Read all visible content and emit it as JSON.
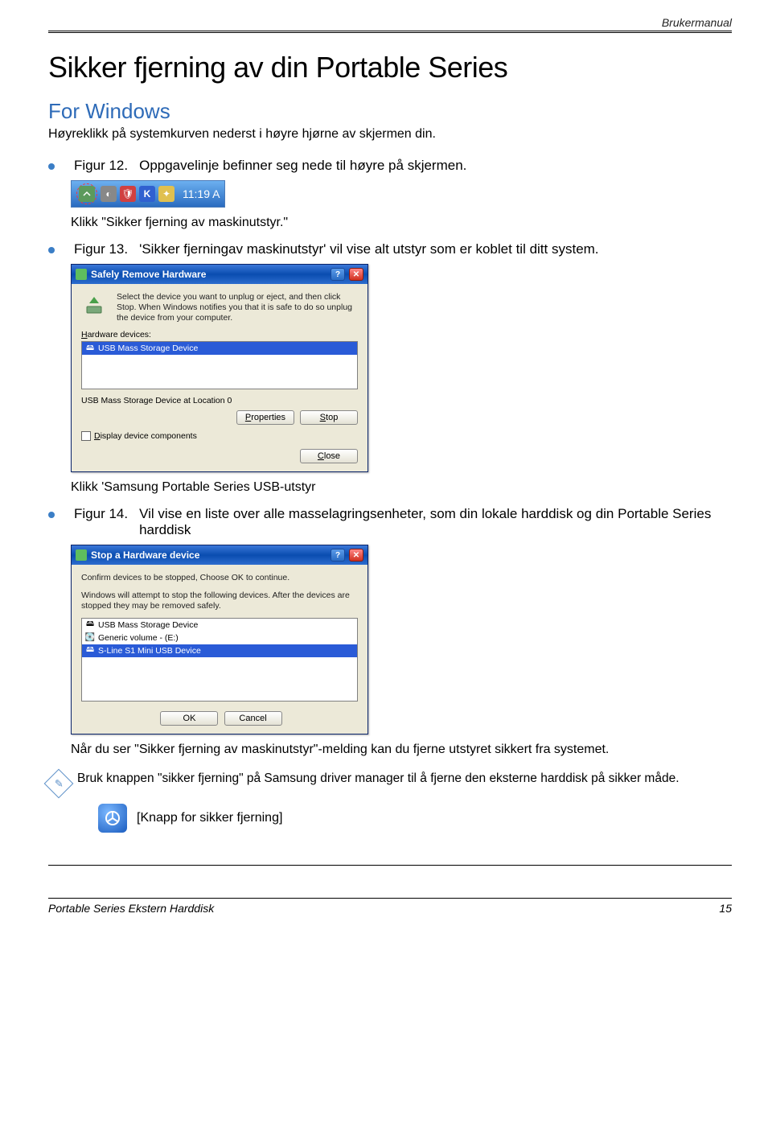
{
  "header": {
    "doc_type": "Brukermanual"
  },
  "title": "Sikker fjerning av din Portable Series",
  "subtitle": "For Windows",
  "intro": "Høyreklikk på systemkurven nederst i høyre hjørne av skjermen din.",
  "fig12": {
    "name": "Figur 12.",
    "desc": "Oppgavelinje befinner seg nede til høyre på skjermen."
  },
  "taskbar": {
    "clock": "11:19 A"
  },
  "after_fig12": "Klikk \"Sikker fjerning av maskinutstyr.\"",
  "fig13": {
    "name": "Figur 13.",
    "desc": "'Sikker fjerningav maskinutstyr' vil vise alt utstyr som er koblet til ditt system."
  },
  "dialog1": {
    "title": "Safely Remove Hardware",
    "blurb": "Select the device you want to unplug or eject, and then click Stop. When Windows notifies you that it is safe to do so unplug the device from your computer.",
    "hw_label": "Hardware devices:",
    "item": "USB Mass Storage Device",
    "subtext": "USB Mass Storage Device at Location 0",
    "btn_properties": "Properties",
    "btn_stop": "Stop",
    "check_label": "Display device components",
    "btn_close": "Close"
  },
  "after_fig13": "Klikk 'Samsung Portable Series USB-utstyr",
  "fig14": {
    "name": "Figur 14.",
    "desc": "Vil vise en liste over alle masselagringsenheter, som din lokale harddisk og din Portable Series harddisk"
  },
  "dialog2": {
    "title": "Stop a Hardware device",
    "line1": "Confirm devices to be stopped, Choose OK to continue.",
    "line2": "Windows will attempt to stop the following devices. After the devices are stopped they may be removed safely.",
    "items": [
      "USB Mass Storage Device",
      "Generic volume - (E:)",
      "S-Line S1 Mini USB Device"
    ],
    "btn_ok": "OK",
    "btn_cancel": "Cancel"
  },
  "after_fig14": "Når du ser \"Sikker fjerning av maskinutstyr\"-melding kan du fjerne utstyret sikkert fra systemet.",
  "note": "Bruk knappen \"sikker fjerning\" på Samsung driver manager til å fjerne den eksterne harddisk på sikker måde.",
  "knapp": "[Knapp for sikker fjerning]",
  "footer": {
    "left": "Portable Series Ekstern Harddisk",
    "page": "15"
  }
}
